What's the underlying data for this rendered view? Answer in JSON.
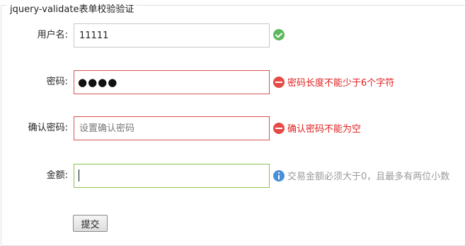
{
  "form": {
    "legend": "jquery-validate表单校验验证",
    "fields": [
      {
        "label": "用户名:",
        "value": "11111",
        "placeholder": "",
        "status": "valid",
        "icon": "check-icon"
      },
      {
        "label": "密码:",
        "value": "●●●●",
        "placeholder": "",
        "status": "error",
        "icon": "minus-circle-icon",
        "message": "密码长度不能少于6个字符"
      },
      {
        "label": "确认密码:",
        "value": "",
        "placeholder": "设置确认密码",
        "status": "error",
        "icon": "minus-circle-icon",
        "message": "确认密码不能为空"
      },
      {
        "label": "金额:",
        "value": "",
        "placeholder": "",
        "status": "focused",
        "icon": "info-icon",
        "message": "交易金额必须大于0，且最多有两位小数"
      }
    ],
    "submit_label": "提交"
  },
  "colors": {
    "error": "#e02020",
    "valid": "#5cb85c",
    "info": "#4a90d9",
    "hint_text": "#9a9a9a"
  }
}
